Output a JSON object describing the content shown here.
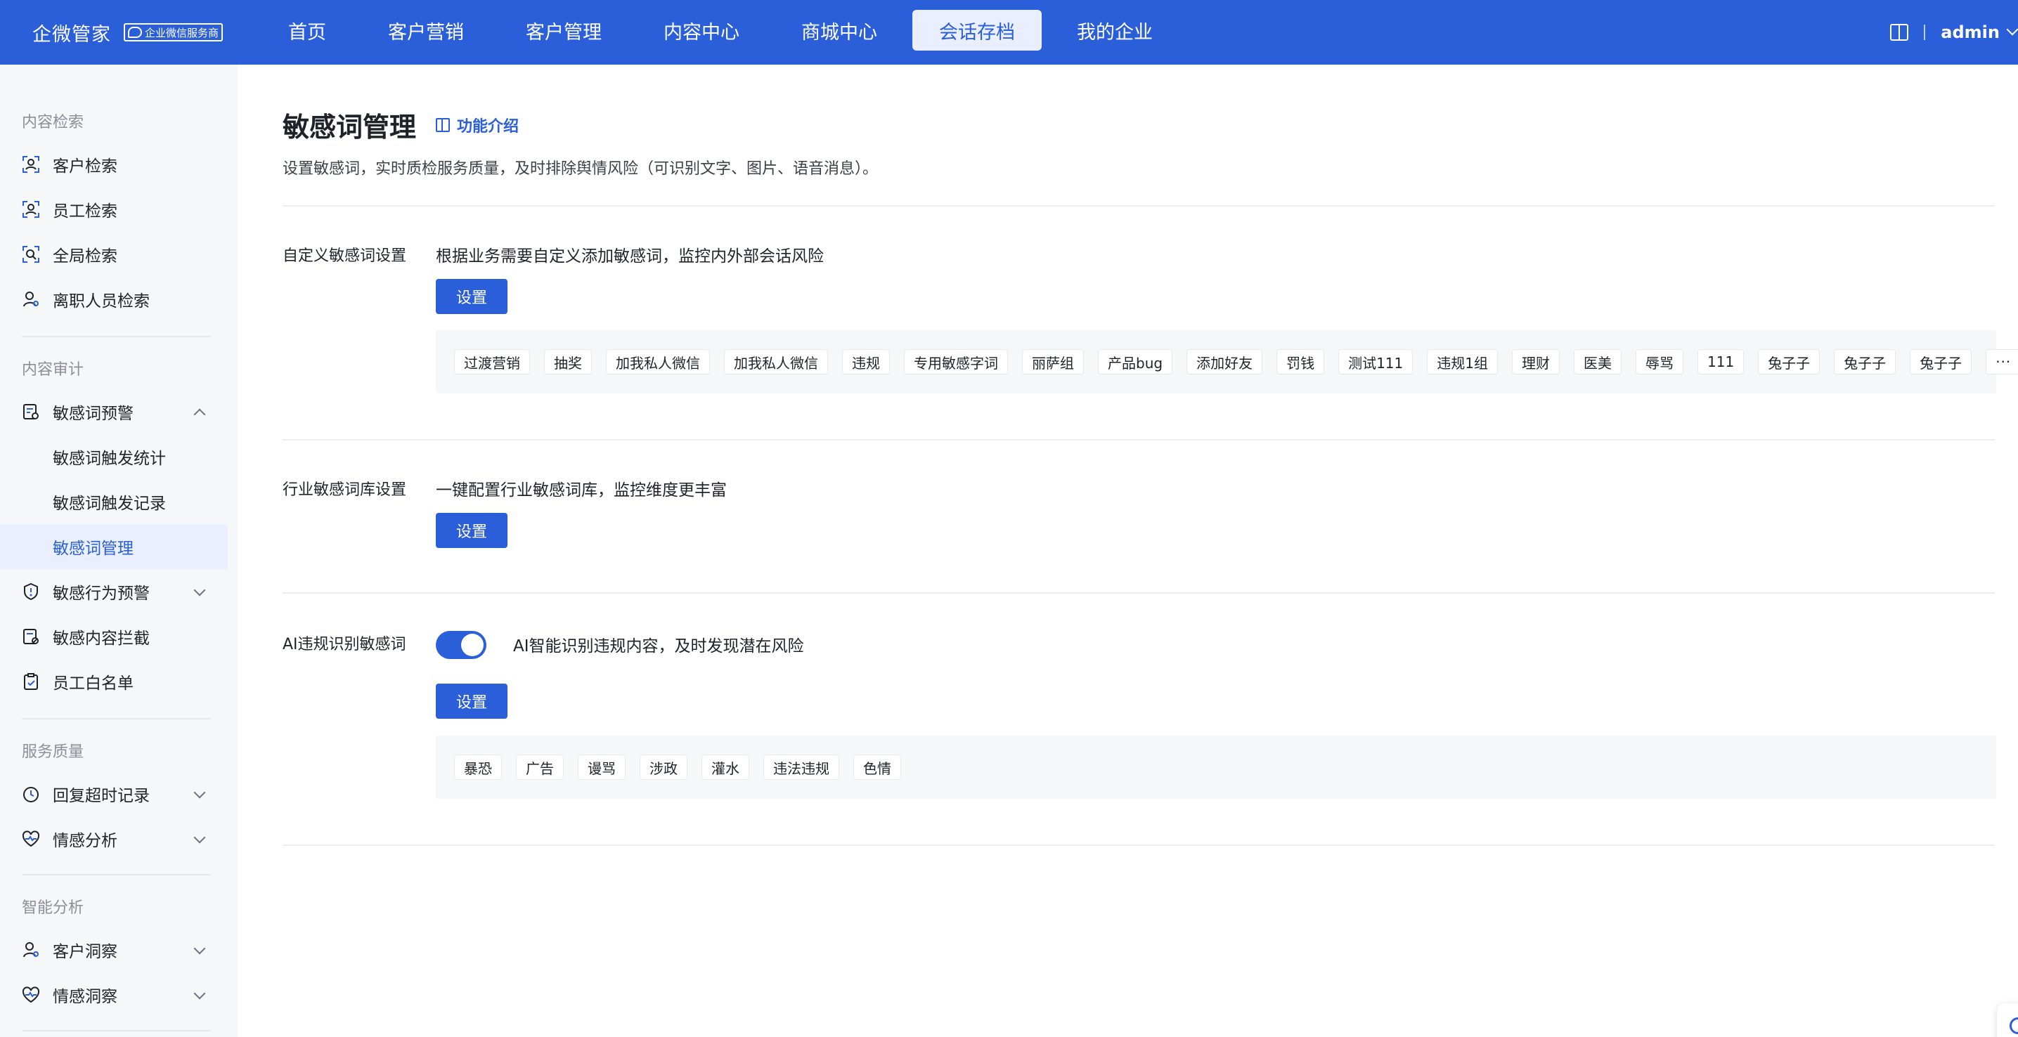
{
  "header": {
    "brand": "企微管家",
    "badge": "企业微信服务商",
    "nav": [
      "首页",
      "客户营销",
      "客户管理",
      "内容中心",
      "商城中心",
      "会话存档",
      "我的企业"
    ],
    "active_nav": "会话存档",
    "user": "admin",
    "accent": "#2b5fd9"
  },
  "sidebar": {
    "groups": [
      {
        "title": "内容检索",
        "items": [
          "客户检索",
          "员工检索",
          "全局检索",
          "离职人员检索"
        ]
      },
      {
        "title": "内容审计",
        "items": [
          "敏感词预警",
          "敏感词触发统计",
          "敏感词触发记录",
          "敏感词管理",
          "敏感行为预警",
          "敏感内容拦截",
          "员工白名单"
        ]
      },
      {
        "title": "服务质量",
        "items": [
          "回复超时记录",
          "情感分析"
        ]
      },
      {
        "title": "智能分析",
        "items": [
          "客户洞察",
          "情感洞察"
        ]
      }
    ],
    "active_item": "敏感词管理"
  },
  "main": {
    "title": "敏感词管理",
    "intro_link": "功能介绍",
    "description": "设置敏感词，实时质检服务质量，及时排除舆情风险（可识别文字、图片、语音消息）。",
    "sections": [
      {
        "label": "自定义敏感词设置",
        "desc": "根据业务需要自定义添加敏感词，监控内外部会话风险",
        "button": "设置",
        "tags": [
          "过渡营销",
          "抽奖",
          "加我私人微信",
          "加我私人微信",
          "违规",
          "专用敏感字词",
          "丽萨组",
          "产品bug",
          "添加好友",
          "罚钱",
          "测试111",
          "违规1组",
          "理财",
          "医美",
          "辱骂",
          "111",
          "兔子子",
          "兔子子",
          "兔子子",
          "···"
        ]
      },
      {
        "label": "行业敏感词库设置",
        "desc": "一键配置行业敏感词库，监控维度更丰富",
        "button": "设置"
      },
      {
        "label": "AI违规识别敏感词",
        "toggle_on": true,
        "desc": "AI智能识别违规内容，及时发现潜在风险",
        "button": "设置",
        "tags": [
          "暴恐",
          "广告",
          "谩骂",
          "涉政",
          "灌水",
          "违法违规",
          "色情"
        ]
      }
    ]
  }
}
